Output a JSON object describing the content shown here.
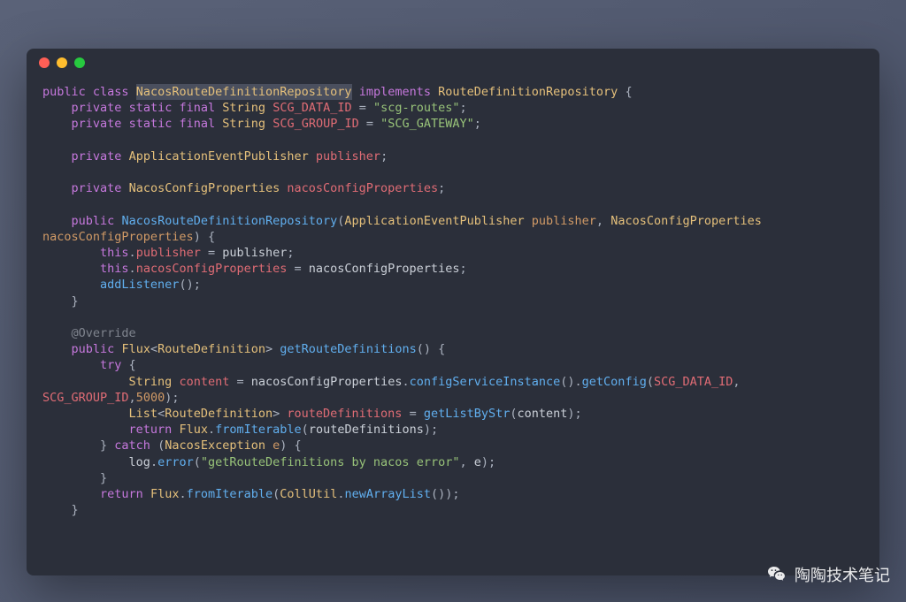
{
  "code": {
    "line1": {
      "kw1": "public",
      "kw2": "class",
      "cls": "NacosRouteDefinitionRepository",
      "kw3": "implements",
      "iface": "RouteDefinitionRepository",
      "brace": " {"
    },
    "line2": {
      "indent": "    ",
      "kw1": "private",
      "kw2": "static",
      "kw3": "final",
      "type": "String",
      "name": "SCG_DATA_ID",
      "eq": " = ",
      "str": "\"scg-routes\"",
      "semi": ";"
    },
    "line3": {
      "indent": "    ",
      "kw1": "private",
      "kw2": "static",
      "kw3": "final",
      "type": "String",
      "name": "SCG_GROUP_ID",
      "eq": " = ",
      "str": "\"SCG_GATEWAY\"",
      "semi": ";"
    },
    "line4": "",
    "line5": {
      "indent": "    ",
      "kw": "private",
      "type": "ApplicationEventPublisher",
      "name": "publisher",
      "semi": ";"
    },
    "line6": "",
    "line7": {
      "indent": "    ",
      "kw": "private",
      "type": "NacosConfigProperties",
      "name": "nacosConfigProperties",
      "semi": ";"
    },
    "line8": "",
    "line9": {
      "indent": "    ",
      "kw": "public",
      "ctor": "NacosRouteDefinitionRepository",
      "open": "(",
      "p1t": "ApplicationEventPublisher",
      "p1n": "publisher",
      "comma": ", ",
      "p2t": "NacosConfigProperties"
    },
    "line9b": {
      "p2n": "nacosConfigProperties",
      "close": ") {"
    },
    "line10": {
      "indent": "        ",
      "this": "this",
      "dot": ".",
      "field": "publisher",
      "eq": " = ",
      "val": "publisher",
      "semi": ";"
    },
    "line11": {
      "indent": "        ",
      "this": "this",
      "dot": ".",
      "field": "nacosConfigProperties",
      "eq": " = ",
      "val": "nacosConfigProperties",
      "semi": ";"
    },
    "line12": {
      "indent": "        ",
      "fn": "addListener",
      "call": "();"
    },
    "line13": {
      "indent": "    ",
      "brace": "}"
    },
    "line14": "",
    "line15": {
      "indent": "    ",
      "ann": "@Override"
    },
    "line16": {
      "indent": "    ",
      "kw": "public",
      "ret": "Flux",
      "lt": "<",
      "gen": "RouteDefinition",
      "gt": "> ",
      "fn": "getRouteDefinitions",
      "call": "() {"
    },
    "line17": {
      "indent": "        ",
      "kw": "try",
      "brace": " {"
    },
    "line18": {
      "indent": "            ",
      "type": "String",
      "name": "content",
      "eq": " = ",
      "obj": "nacosConfigProperties",
      "dot1": ".",
      "m1": "configServiceInstance",
      "c1": "().",
      "m2": "getConfig",
      "open": "(",
      "a1": "SCG_DATA_ID",
      "comma": ","
    },
    "line18b": {
      "a2": "SCG_GROUP_ID",
      "comma": ",",
      "num": "5000",
      "close": ");"
    },
    "line19": {
      "indent": "            ",
      "type": "List",
      "lt": "<",
      "gen": "RouteDefinition",
      "gt": "> ",
      "name": "routeDefinitions",
      "eq": " = ",
      "fn": "getListByStr",
      "open": "(",
      "arg": "content",
      "close": ");"
    },
    "line20": {
      "indent": "            ",
      "kw": "return",
      "sp": " ",
      "cls": "Flux",
      "dot": ".",
      "fn": "fromIterable",
      "open": "(",
      "arg": "routeDefinitions",
      "close": ");"
    },
    "line21": {
      "indent": "        ",
      "brace": "} ",
      "kw": "catch",
      "open": " (",
      "type": "NacosException",
      "name": "e",
      "close": ") {"
    },
    "line22": {
      "indent": "            ",
      "obj": "log",
      "dot": ".",
      "fn": "error",
      "open": "(",
      "str": "\"getRouteDefinitions by nacos error\"",
      "comma": ", ",
      "arg": "e",
      "close": ");"
    },
    "line23": {
      "indent": "        ",
      "brace": "}"
    },
    "line24": {
      "indent": "        ",
      "kw": "return",
      "sp": " ",
      "cls": "Flux",
      "dot": ".",
      "fn": "fromIterable",
      "open": "(",
      "cls2": "CollUtil",
      "dot2": ".",
      "fn2": "newArrayList",
      "call": "()",
      "close": ");"
    },
    "line25": {
      "indent": "    ",
      "brace": "}"
    }
  },
  "watermark": {
    "text": "陶陶技术笔记"
  }
}
